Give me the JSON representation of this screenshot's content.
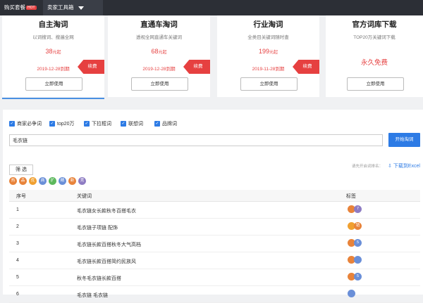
{
  "topbar": {
    "buy_label": "购买套餐",
    "hot_label": "HOT",
    "toolbox_label": "卖家工具箱"
  },
  "cards": [
    {
      "title": "自主淘词",
      "desc": "以词搜词、搜遍全网",
      "price": "38",
      "price_unit": "元起",
      "expire": "2019-12-28到期",
      "renew": "续费",
      "button": "立即使用"
    },
    {
      "title": "直通车淘词",
      "desc": "透视全网直通车关键词",
      "price": "68",
      "price_unit": "元起",
      "expire": "2019-12-28到期",
      "renew": "续费",
      "button": "立即使用"
    },
    {
      "title": "行业淘词",
      "desc": "全类目关键词随时查",
      "price": "199",
      "price_unit": "元起",
      "expire": "2019-11-28到期",
      "renew": "续费",
      "button": "立即使用"
    },
    {
      "title": "官方词库下载",
      "desc": "TOP20万关键词下载",
      "free": "永久免费",
      "button": "立即使用"
    }
  ],
  "checkboxes": [
    "商家必争词",
    "top20万",
    "下拉框词",
    "联想词",
    "品牌词"
  ],
  "search": {
    "value": "毛衣链",
    "button": "开始淘词"
  },
  "filter_label": "筛 选",
  "hint": "请先开启词排名：",
  "export_label": "下载到Excel",
  "badges": [
    {
      "label": "热",
      "color": "#e8833a"
    },
    {
      "label": "品",
      "color": "#e8833a"
    },
    {
      "label": "优",
      "color": "#f0a030"
    },
    {
      "label": "商",
      "color": "#6a8fd8"
    },
    {
      "label": "扩",
      "color": "#5cb85c"
    },
    {
      "label": "精",
      "color": "#6a8fd8"
    },
    {
      "label": "新",
      "color": "#e8833a"
    },
    {
      "label": "竞",
      "color": "#8e7cc3"
    }
  ],
  "table": {
    "headers": [
      "序号",
      "关键词",
      "标签"
    ],
    "rows": [
      {
        "index": "1",
        "keyword": "毛衣链女长款秋冬百搭毛衣",
        "tags": [
          {
            "label": "",
            "color": "#e8833a"
          },
          {
            "label": "7",
            "color": "#8e7cc3"
          }
        ]
      },
      {
        "index": "2",
        "keyword": "毛衣链子项链 配饰",
        "tags": [
          {
            "label": "",
            "color": "#f0a030"
          },
          {
            "label": "销",
            "color": "#e8833a"
          }
        ]
      },
      {
        "index": "3",
        "keyword": "毛衣链长款百搭秋冬大气高档",
        "tags": [
          {
            "label": "",
            "color": "#e8833a"
          },
          {
            "label": "5",
            "color": "#6a8fd8"
          }
        ]
      },
      {
        "index": "4",
        "keyword": "毛衣链长款百搭简约民族风",
        "tags": [
          {
            "label": "",
            "color": "#e8833a"
          },
          {
            "label": "",
            "color": "#6a8fd8"
          }
        ]
      },
      {
        "index": "5",
        "keyword": "秋冬毛衣链长款百搭",
        "tags": [
          {
            "label": "",
            "color": "#e8833a"
          },
          {
            "label": "5",
            "color": "#6a8fd8"
          }
        ]
      },
      {
        "index": "6",
        "keyword": "毛衣链 毛衣链",
        "tags": [
          {
            "label": "",
            "color": "#6a8fd8"
          }
        ]
      }
    ]
  }
}
